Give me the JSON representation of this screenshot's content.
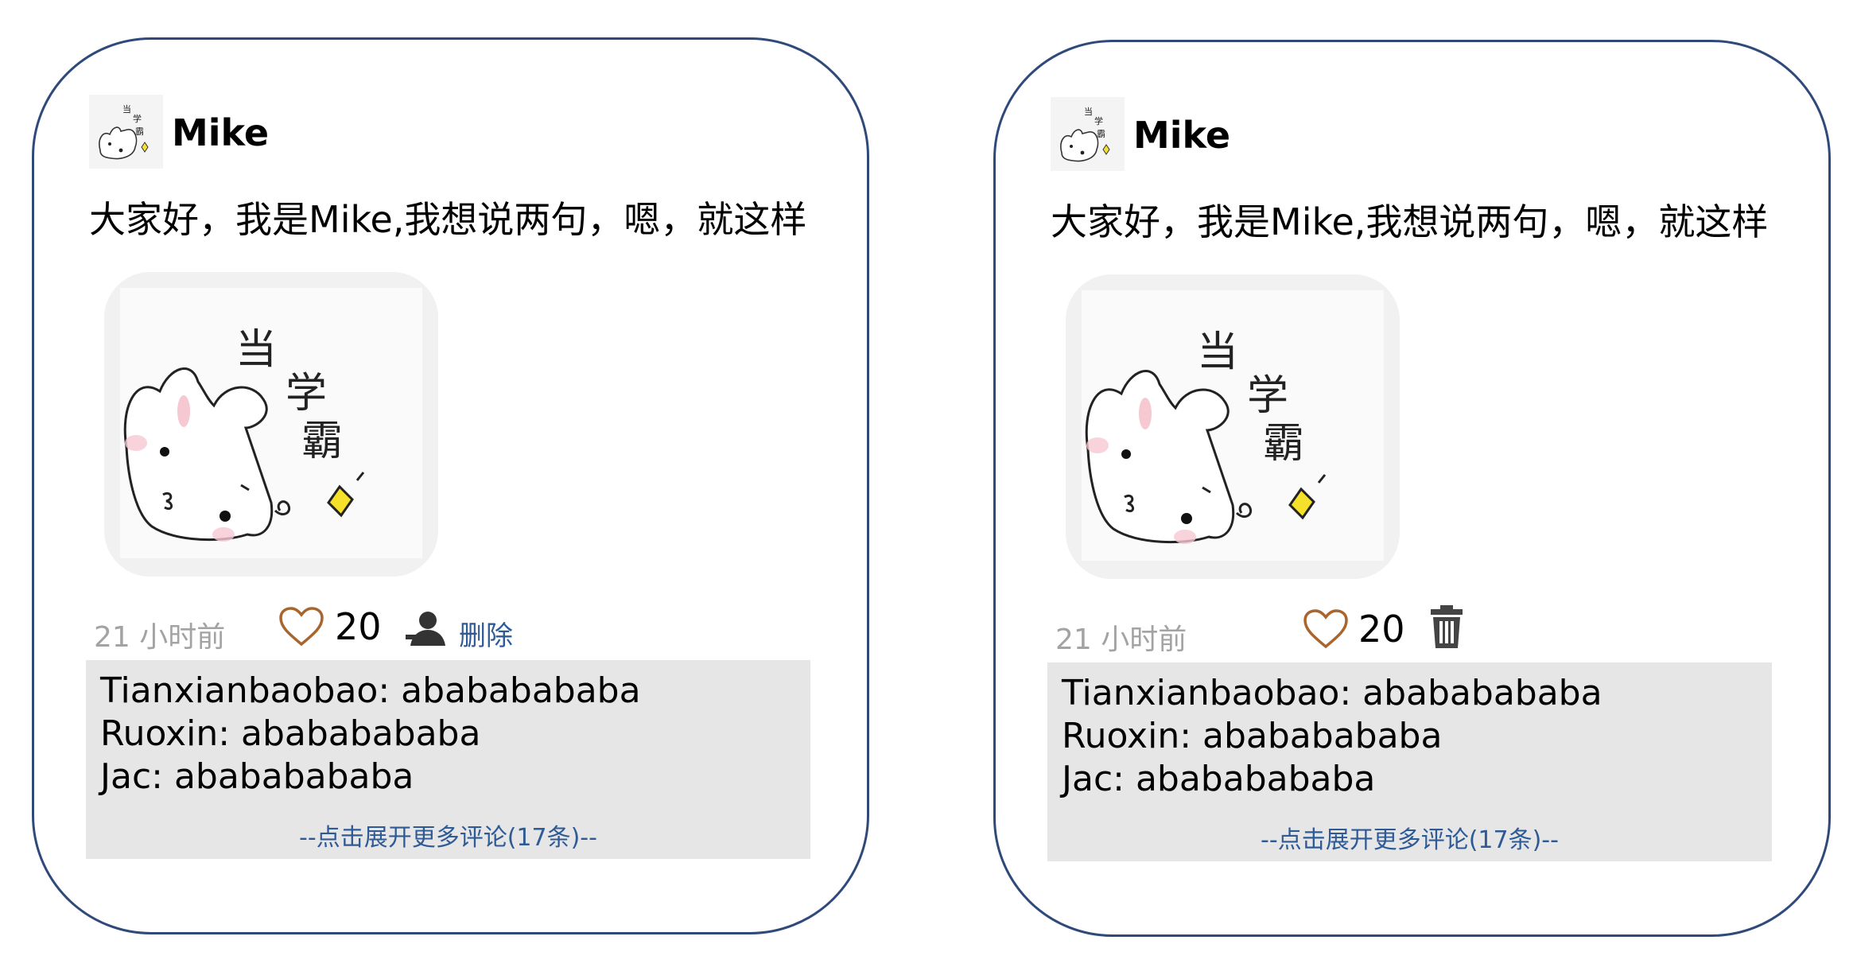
{
  "posts": [
    {
      "username": "Mike",
      "text": "大家好，我是Mike,我想说两句，嗯，就这样",
      "time": "21 小时前",
      "likes": "20",
      "delete_label": "删除",
      "delete_icon": "person-delete-icon",
      "comments": [
        {
          "text": "Tianxianbaobao: abababababa"
        },
        {
          "text": "Ruoxin: abababababa"
        },
        {
          "text": "Jac: abababababa"
        }
      ],
      "expand_label": "--点击展开更多评论(17条)--"
    },
    {
      "username": "Mike",
      "text": "大家好，我是Mike,我想说两句，嗯，就这样",
      "time": "21 小时前",
      "likes": "20",
      "delete_icon": "trash-icon",
      "comments": [
        {
          "text": "Tianxianbaobao: abababababa"
        },
        {
          "text": "Ruoxin: abababababa"
        },
        {
          "text": "Jac: abababababa"
        }
      ],
      "expand_label": "--点击展开更多评论(17条)--"
    }
  ],
  "colors": {
    "card_border": "#2f4a7a",
    "heart": "#a8652e",
    "link": "#2e5a95",
    "comment_bg": "#e7e6e7",
    "time": "#a3a3a3"
  }
}
